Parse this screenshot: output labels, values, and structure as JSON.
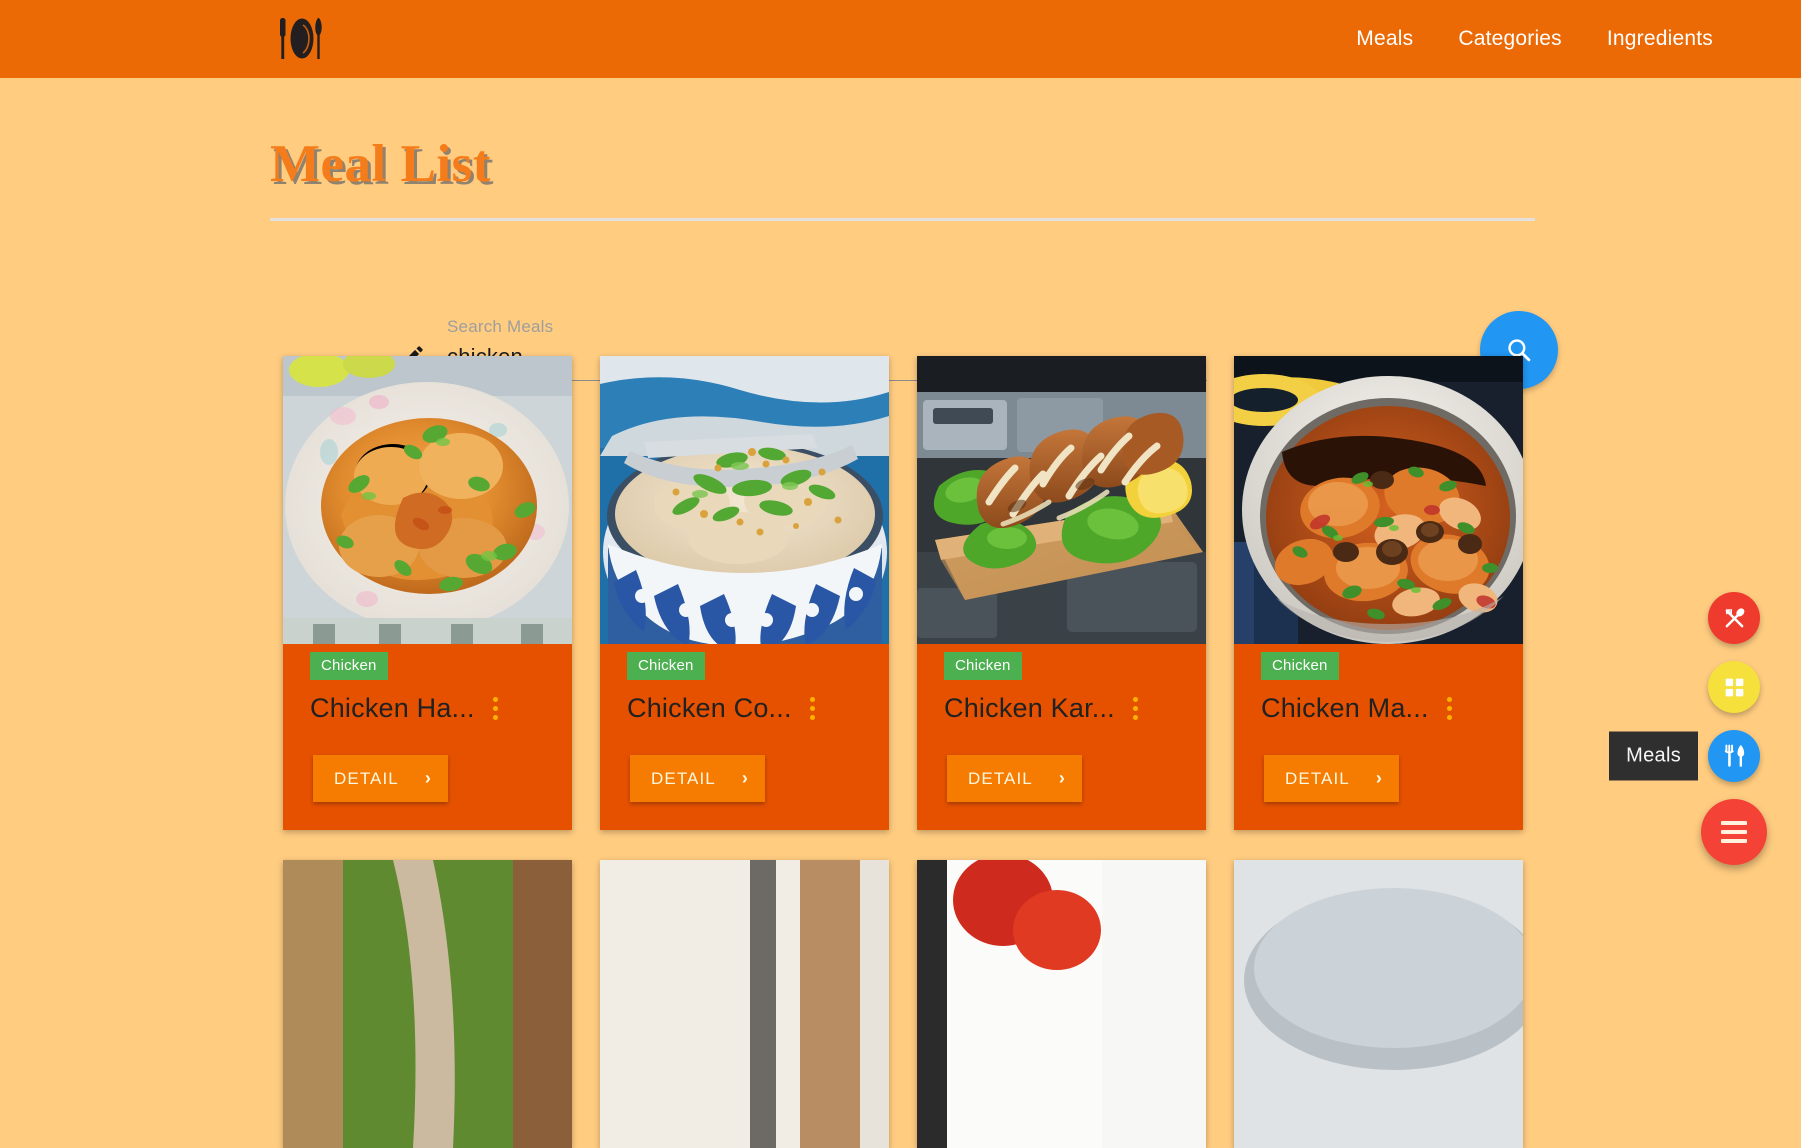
{
  "navbar": {
    "brand_icon": "cutlery-plate-logo-icon",
    "background": "#ec6a05",
    "links": [
      {
        "label": "Meals"
      },
      {
        "label": "Categories"
      },
      {
        "label": "Ingredients"
      }
    ]
  },
  "page": {
    "background": "#ffcc80",
    "title": "Meal List"
  },
  "search": {
    "label": "Search Meals",
    "value": "chicken",
    "placeholder": "Search Meals",
    "edit_icon": "pencil-icon",
    "button_icon": "search-icon",
    "button_color": "#2196f3"
  },
  "cards": [
    {
      "category": "Chicken",
      "title": "Chicken Ha...",
      "detail_label": "DETAIL",
      "image_alt": "chicken-handi-curry-on-floral-plate"
    },
    {
      "category": "Chicken",
      "title": "Chicken Co...",
      "detail_label": "DETAIL",
      "image_alt": "chicken-congee-in-blue-patterned-bowl"
    },
    {
      "category": "Chicken",
      "title": "Chicken Kar...",
      "detail_label": "DETAIL",
      "image_alt": "chicken-karaage-on-wooden-board-with-lettuce"
    },
    {
      "category": "Chicken",
      "title": "Chicken Ma...",
      "detail_label": "DETAIL",
      "image_alt": "chicken-marengo-in-dutch-oven"
    }
  ],
  "second_row": [
    {
      "image_alt": "grass-and-path-partial"
    },
    {
      "image_alt": "white-dish-partial"
    },
    {
      "image_alt": "red-tomato-partial"
    },
    {
      "image_alt": "grey-bowl-partial"
    }
  ],
  "fabs": {
    "tooltip": "Meals",
    "items": [
      {
        "name": "ingredients-fab",
        "icon": "crossed-spoon-fork-icon",
        "color": "#ef3b2d"
      },
      {
        "name": "categories-fab",
        "icon": "category-icon",
        "color": "#f5e03c"
      },
      {
        "name": "meals-fab",
        "icon": "fork-knife-icon",
        "color": "#2196f3"
      }
    ],
    "main": {
      "name": "menu-fab",
      "icon": "hamburger-menu-icon",
      "color": "#f44336"
    }
  },
  "badge_color": "#4caf50",
  "card_color": "#e65100",
  "detail_color": "#f57c00"
}
